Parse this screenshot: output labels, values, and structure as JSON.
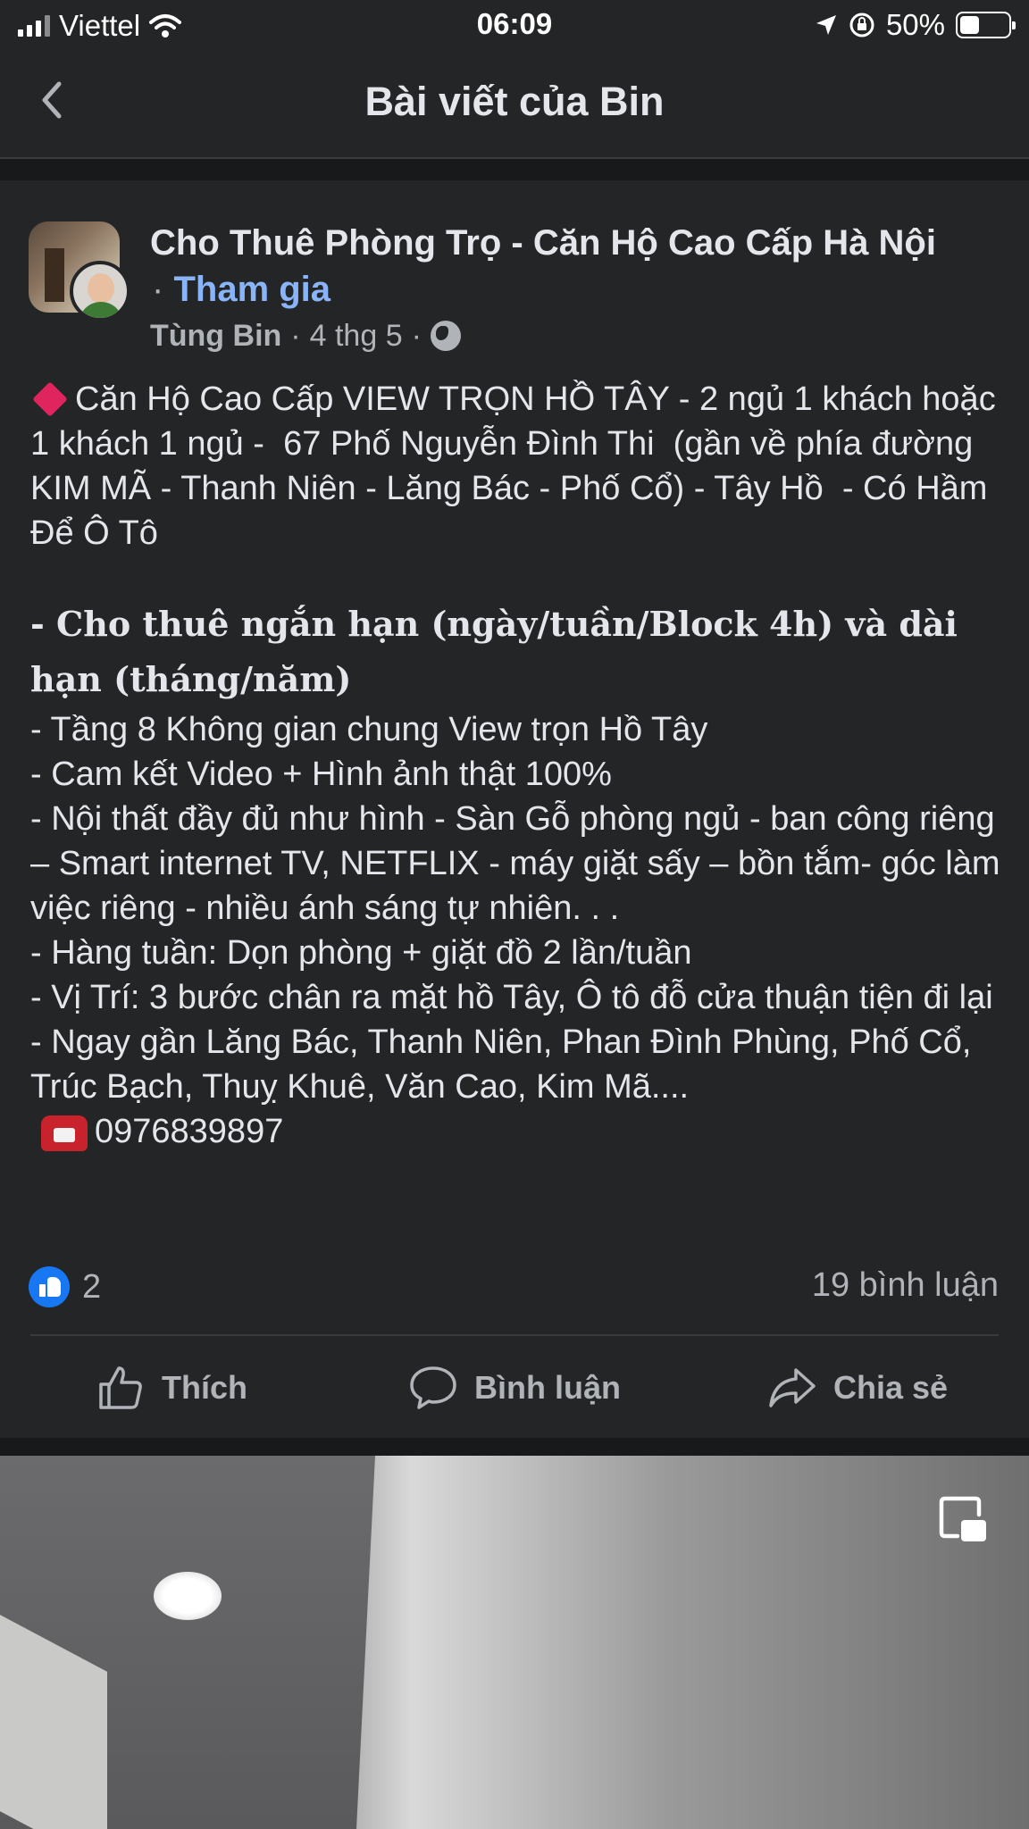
{
  "status_bar": {
    "carrier": "Viettel",
    "time": "06:09",
    "battery": "50%",
    "battery_level": 0.4
  },
  "nav": {
    "title": "Bài viết của Bin"
  },
  "post": {
    "group_name": "Cho Thuê Phòng Trọ - Căn Hộ Cao Cấp Hà Nội",
    "join_separator": "·",
    "join_label": "Tham gia",
    "author": "Tùng Bin",
    "date": "4 thg 5",
    "meta_separator": "·",
    "body_intro": "Căn Hộ Cao Cấp VIEW TRỌN HỒ TÂY - 2 ngủ 1 khách hoặc 1 khách 1 ngủ -  67 Phố Nguyễn Đình Thi  (gần về phía đường KIM MÃ - Thanh Niên - Lăng Bác - Phố Cổ) - Tây Hồ  - Có Hầm Để Ô Tô",
    "body_bold": "- Cho thuê ngắn hạn (ngày/tuần/Block 4h) và dài hạn (tháng/năm)",
    "body_lines": [
      "- Tầng 8 Không gian chung View trọn Hồ Tây",
      "- Cam kết Video + Hình ảnh thật 100%",
      "- Nội thất đầy đủ như hình - Sàn Gỗ phòng ngủ - ban công riêng – Smart internet TV, NETFLIX - máy giặt sấy – bồn tắm- góc làm việc riêng - nhiều ánh sáng tự nhiên. . .",
      "- Hàng tuần: Dọn phòng + giặt đồ 2 lần/tuần",
      "- Vị Trí: 3 bước chân ra mặt hồ Tây, Ô tô đỗ cửa thuận tiện đi lại - Ngay gần Lăng Bác, Thanh Niên, Phan Đình Phùng, Phố Cổ, Trúc Bạch, Thuỵ Khuê, Văn Cao, Kim Mã...."
    ],
    "phone": "0976839897",
    "likes": "2",
    "comments": "19 bình luận"
  },
  "actions": {
    "like": "Thích",
    "comment": "Bình luận",
    "share": "Chia sẻ"
  },
  "colors": {
    "background": "#18191a",
    "card": "#242526",
    "text": "#e4e6eb",
    "secondary_text": "#b0b3b8",
    "link": "#8ab4f8",
    "like_blue": "#1877f2"
  },
  "icons": [
    "signal-icon",
    "wifi-icon",
    "location-arrow-icon",
    "orientation-lock-icon",
    "battery-icon",
    "back-chevron-icon",
    "globe-icon",
    "diamond-icon",
    "telephone-icon",
    "like-reaction-icon",
    "thumb-up-icon",
    "comment-icon",
    "share-icon",
    "picture-in-picture-icon"
  ]
}
